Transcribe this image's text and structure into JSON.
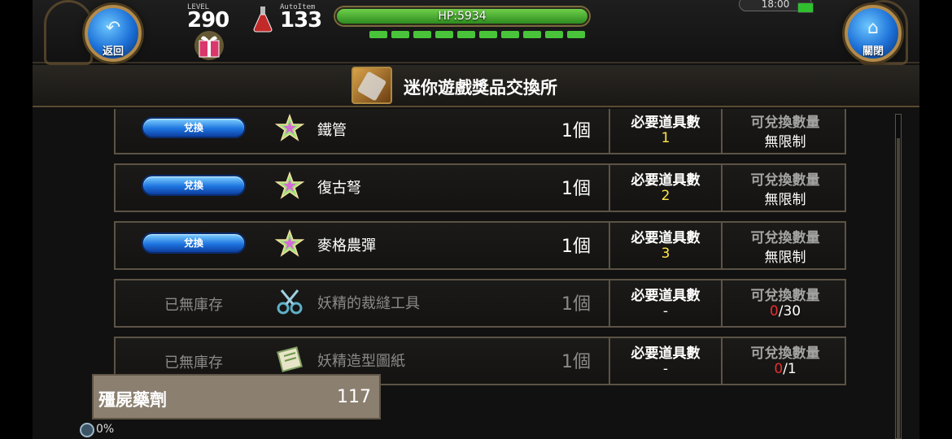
{
  "hud": {
    "back_label": "返回",
    "close_label": "關閉",
    "level_caption": "LEVEL",
    "level_value": "290",
    "autoitem_caption": "AutoItem",
    "autoitem_value": "133",
    "hp_text": "HP:5934",
    "clock": "18:00"
  },
  "title": "迷你遊戲獎品交換所",
  "rows": [
    {
      "button": "兌換",
      "name": "鐵管",
      "qty": "1個",
      "req_label": "必要道具數",
      "req_value": "1",
      "lim_label": "可兌換數量",
      "lim_value": "無限制"
    },
    {
      "button": "兌換",
      "name": "復古弩",
      "qty": "1個",
      "req_label": "必要道具數",
      "req_value": "2",
      "lim_label": "可兌換數量",
      "lim_value": "無限制"
    },
    {
      "button": "兌換",
      "name": "麥格農彈",
      "qty": "1個",
      "req_label": "必要道具數",
      "req_value": "3",
      "lim_label": "可兌換數量",
      "lim_value": "無限制"
    },
    {
      "status": "已無庫存",
      "name": "妖精的裁縫工具",
      "qty": "1個",
      "req_label": "必要道具數",
      "req_value": "-",
      "lim_label": "可兌換數量",
      "lim_used": "0",
      "lim_total": "/30"
    },
    {
      "status": "已無庫存",
      "name": "妖精造型圖紙",
      "qty": "1個",
      "req_label": "必要道具數",
      "req_value": "-",
      "lim_label": "可兌換數量",
      "lim_used": "0",
      "lim_total": "/1"
    }
  ],
  "currency": {
    "name": "殭屍藥劑",
    "count": "117"
  },
  "progress": {
    "percent": "0%"
  },
  "colors": {
    "accent_blue": "#1e75e0",
    "hp_green": "#49c43a",
    "required_yellow": "#ffe64a",
    "limit_red": "#e53030"
  }
}
